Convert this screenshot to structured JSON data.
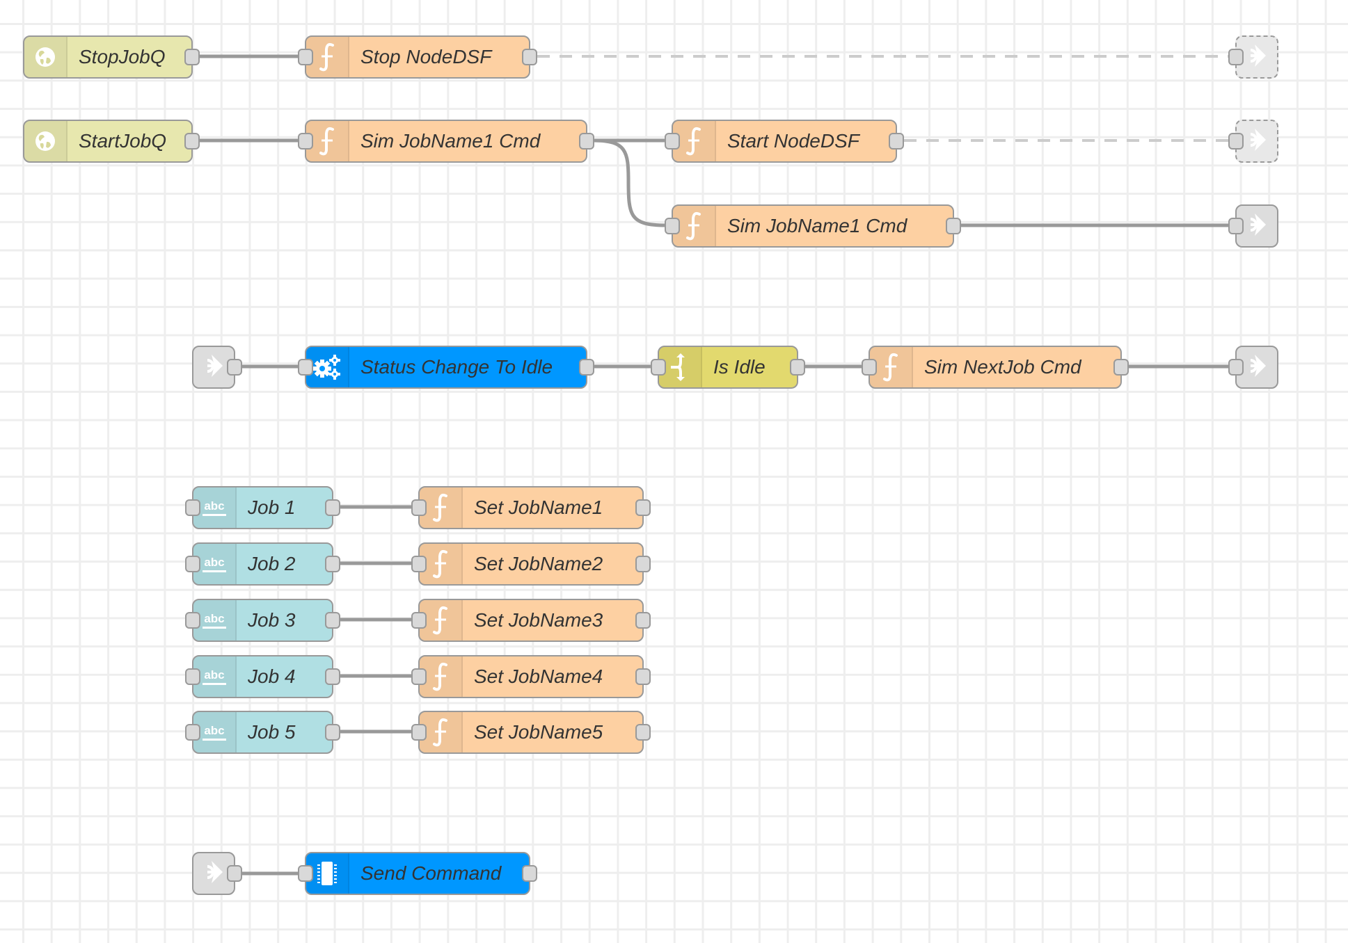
{
  "canvas": {
    "grid": true
  },
  "colors": {
    "inject": "#e7e7ae",
    "function": "#fdd0a2",
    "status": "#0097ff",
    "switch": "#e2d96e",
    "inject_string": "#b0dfe3",
    "link": "#dddddd",
    "wire": "#999999",
    "wire_disabled": "#cccccc"
  },
  "flows": {
    "row1": {
      "inject": {
        "label": "StopJobQ",
        "icon": "globe-icon"
      },
      "function": {
        "label": "Stop NodeDSF",
        "icon": "function-icon"
      },
      "link_out": {
        "icon": "link-out-icon",
        "disabled": true
      }
    },
    "row2": {
      "inject": {
        "label": "StartJobQ",
        "icon": "globe-icon"
      },
      "function": {
        "label": "Sim JobName1 Cmd",
        "icon": "function-icon"
      },
      "function_start": {
        "label": "Start NodeDSF",
        "icon": "function-icon"
      },
      "link_out": {
        "icon": "link-out-icon",
        "disabled": true
      }
    },
    "row3": {
      "function": {
        "label": "Sim JobName1 Cmd",
        "icon": "function-icon"
      },
      "link_out": {
        "icon": "link-out-icon",
        "disabled": false
      }
    },
    "row4": {
      "link_in": {
        "icon": "link-in-icon"
      },
      "status": {
        "label": "Status Change To Idle",
        "icon": "gears-icon"
      },
      "switch": {
        "label": "Is Idle",
        "icon": "switch-icon"
      },
      "function": {
        "label": "Sim NextJob Cmd",
        "icon": "function-icon"
      },
      "link_out": {
        "icon": "link-out-icon",
        "disabled": false
      }
    },
    "jobs": [
      {
        "inject": "Job 1",
        "function": "Set JobName1"
      },
      {
        "inject": "Job 2",
        "function": "Set JobName2"
      },
      {
        "inject": "Job 3",
        "function": "Set JobName3"
      },
      {
        "inject": "Job 4",
        "function": "Set JobName4"
      },
      {
        "inject": "Job 5",
        "function": "Set JobName5"
      }
    ],
    "row_bottom": {
      "link_in": {
        "icon": "link-in-icon"
      },
      "serial": {
        "label": "Send Command",
        "icon": "chip-icon"
      }
    }
  }
}
